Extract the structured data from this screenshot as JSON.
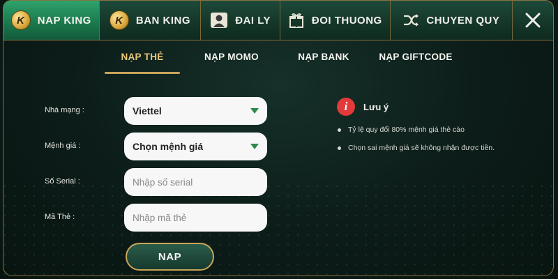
{
  "top_tabs": [
    {
      "label": "NAP KING",
      "icon": "king-coin-icon",
      "active": true
    },
    {
      "label": "BAN KING",
      "icon": "king-coin-icon",
      "active": false
    },
    {
      "label": "ĐAI LY",
      "icon": "agent-icon",
      "active": false
    },
    {
      "label": "ĐOI THUONG",
      "icon": "gift-icon",
      "active": false
    },
    {
      "label": "CHUYEN QUY",
      "icon": "shuffle-icon",
      "active": false
    }
  ],
  "coin_letter": "K",
  "close_icon": "close-icon",
  "sub_tabs": [
    {
      "label": "NẠP THẺ",
      "active": true
    },
    {
      "label": "NẠP MOMO",
      "active": false
    },
    {
      "label": "NẠP BANK",
      "active": false
    },
    {
      "label": "NẠP GIFTCODE",
      "active": false
    }
  ],
  "form": {
    "carrier_label": "Nhà mạng :",
    "carrier_value": "Viettel",
    "amount_label": "Mệnh giá :",
    "amount_value": "Chọn mệnh giá",
    "serial_label": "Số Serial :",
    "serial_placeholder": "Nhập số serial",
    "code_label": "Mã Thẻ :",
    "code_placeholder": "Nhập mã thẻ",
    "submit_label": "NAP"
  },
  "note": {
    "icon": "info-icon",
    "icon_glyph": "i",
    "title": "Lưu ý",
    "items": [
      "Tỷ lệ quy đổi 80% mệnh giá thẻ cào",
      "Chọn sai mệnh giá sẽ không nhận được tiền."
    ]
  },
  "colors": {
    "accent_green": "#1c7a4e",
    "gold": "#c9a55a",
    "alert_red": "#e23a3a"
  }
}
